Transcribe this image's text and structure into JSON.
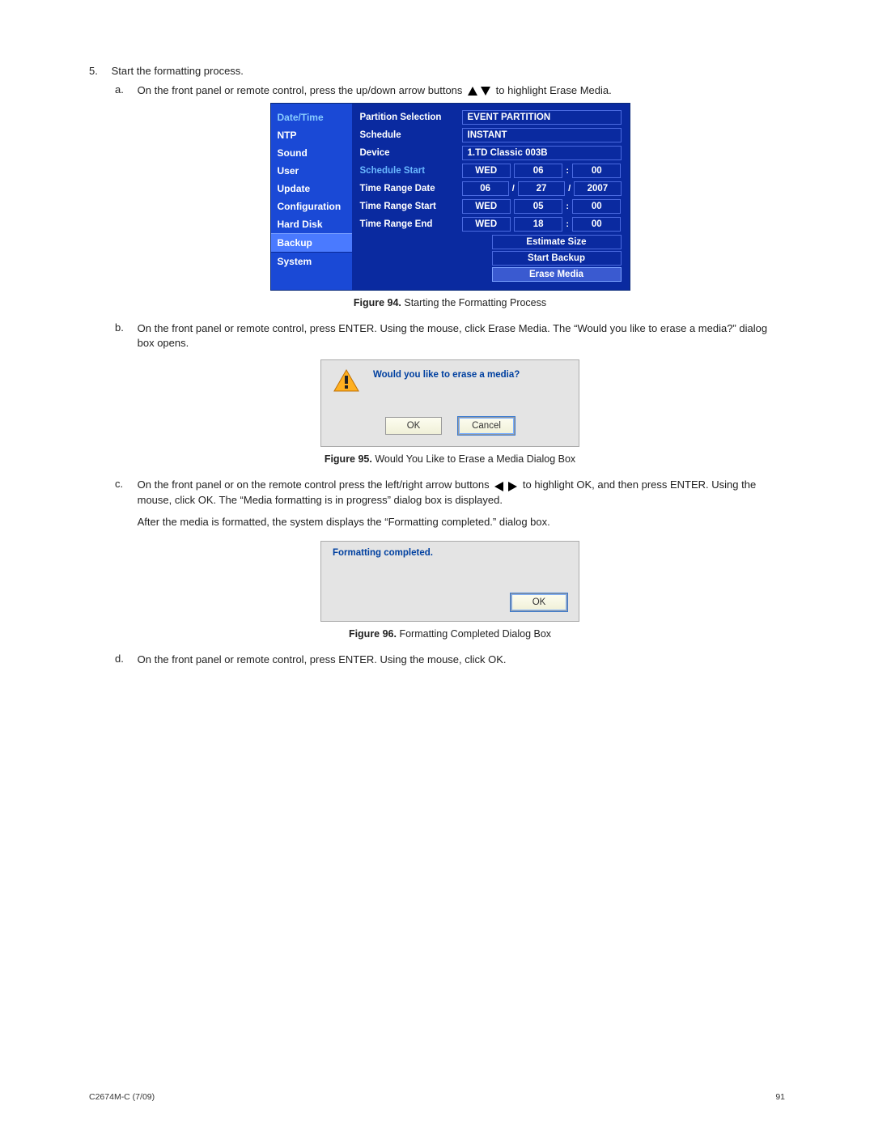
{
  "step5": {
    "number": "5.",
    "title": "Start the formatting process.",
    "a": {
      "letter": "a.",
      "pre": "On the front panel or remote control, press the up/down arrow buttons ",
      "post": " to highlight Erase Media."
    },
    "b": {
      "letter": "b.",
      "text": "On the front panel or remote control, press ENTER. Using the mouse, click Erase Media. The “Would you like to erase a media?” dialog box opens."
    },
    "c": {
      "letter": "c.",
      "pre": "On the front panel or on the remote control press the left/right arrow buttons ",
      "post": " to highlight OK, and then press ENTER. Using the mouse, click OK. The “Media formatting is in progress” dialog box is displayed.",
      "after": "After the media is formatted, the system displays the “Formatting completed.” dialog box."
    },
    "d": {
      "letter": "d.",
      "text": "On the front panel or remote control, press ENTER. Using the mouse, click OK."
    }
  },
  "fig94": {
    "caption_label": "Figure 94.",
    "caption_text": "  Starting the Formatting Process",
    "sidebar": [
      "Date/Time",
      "NTP",
      "Sound",
      "User",
      "Update",
      "Configuration",
      "Hard Disk",
      "Backup",
      "System"
    ],
    "rows": {
      "partition_label": "Partition Selection",
      "partition_val": "EVENT PARTITION",
      "schedule_label": "Schedule",
      "schedule_val": "INSTANT",
      "device_label": "Device",
      "device_val": "1.TD Classic 003B",
      "sched_start_label": "Schedule Start",
      "sched_start_a": "WED",
      "sched_start_b": "06",
      "sched_start_c": "00",
      "trd_label": "Time Range Date",
      "trd_a": "06",
      "trd_b": "27",
      "trd_c": "2007",
      "trs_label": "Time Range Start",
      "trs_a": "WED",
      "trs_b": "05",
      "trs_c": "00",
      "tre_label": "Time Range End",
      "tre_a": "WED",
      "tre_b": "18",
      "tre_c": "00",
      "btn_estimate": "Estimate Size",
      "btn_start": "Start Backup",
      "btn_erase": "Erase Media"
    }
  },
  "fig95": {
    "caption_label": "Figure 95.",
    "caption_text": "  Would You Like to Erase a Media Dialog Box",
    "message": "Would you like to erase a media?",
    "ok": "OK",
    "cancel": "Cancel"
  },
  "fig96": {
    "caption_label": "Figure 96.",
    "caption_text": "  Formatting Completed Dialog Box",
    "message": "Formatting completed.",
    "ok": "OK"
  },
  "footer": {
    "left": "C2674M-C (7/09)",
    "right": "91"
  },
  "sep": {
    "colon": ":",
    "slash": "/"
  }
}
